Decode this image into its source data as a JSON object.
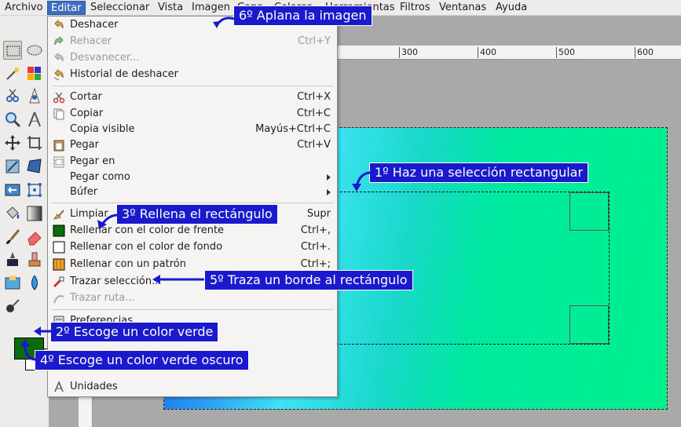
{
  "menubar": {
    "items": [
      "Archivo",
      "Editar",
      "Seleccionar",
      "Vista",
      "Imagen",
      "Capa",
      "Colores",
      "Herramientas",
      "Filtros",
      "Ventanas",
      "Ayuda"
    ],
    "active": "Editar"
  },
  "ruler": {
    "ticks": [
      "300",
      "400",
      "500",
      "600"
    ]
  },
  "edit_menu": {
    "items": [
      {
        "label": "Deshacer",
        "shortcut": "",
        "icon": "undo-icon",
        "disabled": false
      },
      {
        "label": "Rehacer",
        "shortcut": "Ctrl+Y",
        "icon": "redo-icon",
        "disabled": true
      },
      {
        "label": "Desvanecer...",
        "shortcut": "",
        "icon": "fade-icon",
        "disabled": true
      },
      {
        "label": "Historial de deshacer",
        "shortcut": "",
        "icon": "history-icon",
        "disabled": false
      },
      {
        "label": "Cortar",
        "shortcut": "Ctrl+X",
        "icon": "scissors-icon",
        "disabled": false
      },
      {
        "label": "Copiar",
        "shortcut": "Ctrl+C",
        "icon": "copy-icon",
        "disabled": false
      },
      {
        "label": "Copia visible",
        "shortcut": "Mayús+Ctrl+C",
        "icon": "",
        "disabled": false
      },
      {
        "label": "Pegar",
        "shortcut": "Ctrl+V",
        "icon": "paste-icon",
        "disabled": false
      },
      {
        "label": "Pegar en",
        "shortcut": "",
        "icon": "paste-into-icon",
        "disabled": false
      },
      {
        "label": "Pegar como",
        "shortcut": "",
        "icon": "",
        "disabled": false,
        "submenu": true
      },
      {
        "label": "Búfer",
        "shortcut": "",
        "icon": "",
        "disabled": false,
        "submenu": true
      },
      {
        "label": "Limpiar",
        "shortcut": "Supr",
        "icon": "clear-icon",
        "disabled": false
      },
      {
        "label": "Rellenar con el color de frente",
        "shortcut": "Ctrl+,",
        "icon": "fill-fg-icon",
        "disabled": false
      },
      {
        "label": "Rellenar con el color de fondo",
        "shortcut": "Ctrl+.",
        "icon": "fill-bg-icon",
        "disabled": false
      },
      {
        "label": "Rellenar con un patrón",
        "shortcut": "Ctrl+;",
        "icon": "fill-pattern-icon",
        "disabled": false
      },
      {
        "label": "Trazar selección...",
        "shortcut": "",
        "icon": "stroke-selection-icon",
        "disabled": false
      },
      {
        "label": "Trazar ruta...",
        "shortcut": "",
        "icon": "stroke-path-icon",
        "disabled": true
      },
      {
        "label": "Preferencias",
        "shortcut": "",
        "icon": "preferences-icon",
        "disabled": false
      },
      {
        "label": "Unidades",
        "shortcut": "",
        "icon": "units-icon",
        "disabled": false
      }
    ]
  },
  "annotations": {
    "n1": "1º Haz una selección rectangular",
    "n2": "2º Escoge un color verde",
    "n3": "3º Rellena el rectángulo",
    "n4": "4º Escoge un color verde oscuro",
    "n5": "5º Traza un borde al rectángulo",
    "n6": "6º Aplana la imagen"
  },
  "colors": {
    "accent": "#1a1acc",
    "foreground_color": "#0a6d0a",
    "background_color": "#ffffff"
  }
}
